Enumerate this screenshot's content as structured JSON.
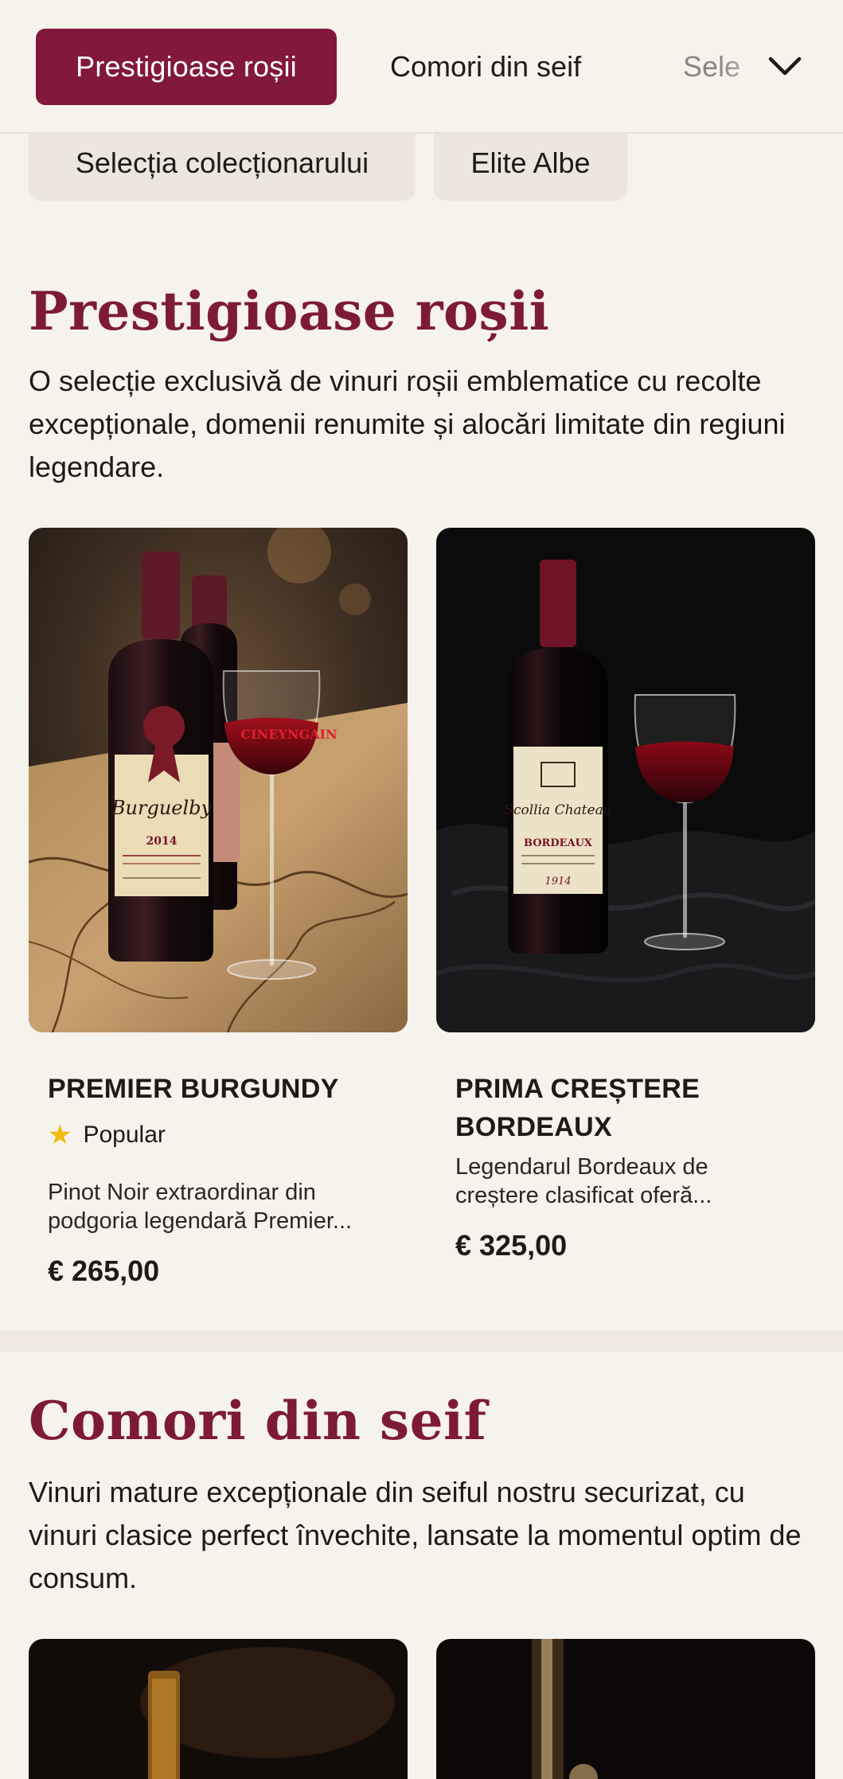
{
  "nav": {
    "tabs": [
      {
        "label": "Prestigioase roșii",
        "active": true
      },
      {
        "label": "Comori din seif",
        "active": false
      },
      {
        "label": "Sele",
        "active": false
      }
    ],
    "more_icon": "chevron-down-icon",
    "sub_tabs": [
      {
        "label": "Selecția colecționarului"
      },
      {
        "label": "Elite Albe"
      }
    ]
  },
  "sections": [
    {
      "title": "Prestigioase roșii",
      "description": "O selecție exclusivă de vinuri roșii emblematice cu recolte excepționale, domenii renumite și alocări limitate din regiuni legendare.",
      "products": [
        {
          "name": "PREMIER BURGUNDY",
          "badge": "Popular",
          "badge_icon": "star-icon",
          "description": "Pinot Noir extraordinar din podgoria legendară Premier...",
          "price": "€ 265,00",
          "label_text": "Burguelby",
          "label_year": "2014",
          "glass_text": "CINEYNGAIN"
        },
        {
          "name": "PRIMA CREȘTERE BORDEAUX",
          "description": "Legendarul Bordeaux de creștere clasificat oferă...",
          "price": "€ 325,00",
          "label_text": "Scollia Chateau",
          "label_region": "BORDEAUX",
          "label_year": "1914"
        }
      ]
    },
    {
      "title": "Comori din seif",
      "description": "Vinuri mature excepționale din seiful nostru securizat, cu vinuri clasice perfect învechite, lansate la momentul optim de consum."
    }
  ],
  "colors": {
    "accent": "#82183c",
    "heading": "#7d1a3a",
    "background": "#f6f2ec",
    "star": "#f2b90f"
  }
}
